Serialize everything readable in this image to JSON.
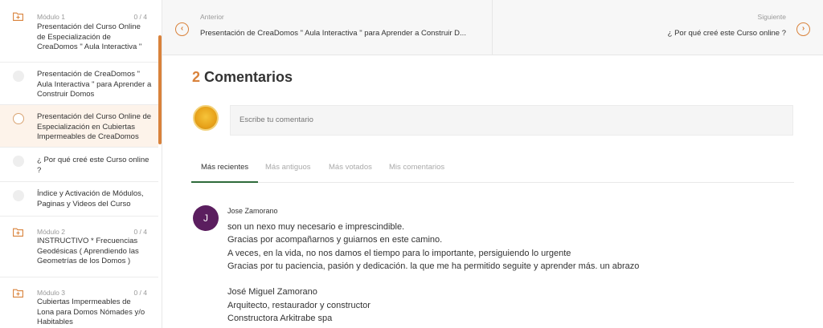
{
  "sidebar": {
    "modules": [
      {
        "label": "Módulo 1",
        "count": "0 / 4",
        "title": "Presentación del Curso Online de Especialización de CreaDomos \" Aula Interactiva \""
      },
      {
        "label": "Módulo 2",
        "count": "0 / 4",
        "title": "INSTRUCTIVO * Frecuencias Geodésicas ( Aprendiendo las Geometrías de los Domos )"
      },
      {
        "label": "Módulo 3",
        "count": "0 / 4",
        "title": "Cubiertas Impermeables de Lona para Domos Nómades y/o Habitables"
      }
    ],
    "lessons": [
      {
        "title": "Presentación de CreaDomos \" Aula Interactiva \" para Aprender a Construir Domos"
      },
      {
        "title": "Presentación del Curso Online de Especialización en Cubiertas Impermeables de CreaDomos"
      },
      {
        "title": "¿ Por qué creé este Curso online ?"
      },
      {
        "title": "Índice y Activación de Módulos, Paginas y Videos del Curso"
      }
    ]
  },
  "nav": {
    "prev_label": "Anterior",
    "prev_title": "Presentación de CreaDomos \" Aula Interactiva \" para Aprender a Construir D...",
    "next_label": "Siguiente",
    "next_title": "¿ Por qué creé este Curso online ?",
    "prev_icon": "‹",
    "next_icon": "›"
  },
  "comments": {
    "count": "2",
    "heading": "Comentarios",
    "placeholder": "Escribe tu comentario",
    "tabs": [
      "Más recientes",
      "Más antiguos",
      "Más votados",
      "Mis comentarios"
    ],
    "items": [
      {
        "avatar_letter": "J",
        "author": "Jose Zamorano",
        "lines": [
          "son un nexo muy necesario e imprescindible.",
          "Gracias por acompañarnos y guiarnos en este camino.",
          "A veces, en la vida, no nos damos el tiempo para lo importante, persiguiendo lo urgente",
          "Gracias por tu paciencia, pasión y dedicación. la que me ha permitido seguite y aprender más. un abrazo",
          "",
          "José Miguel Zamorano",
          "Arquitecto, restaurador y constructor",
          "Constructora Arkitrabe spa"
        ]
      }
    ]
  },
  "colors": {
    "accent": "#d9823b",
    "tab_active": "#2e6b3a",
    "avatar_purple": "#5b1e5f"
  }
}
